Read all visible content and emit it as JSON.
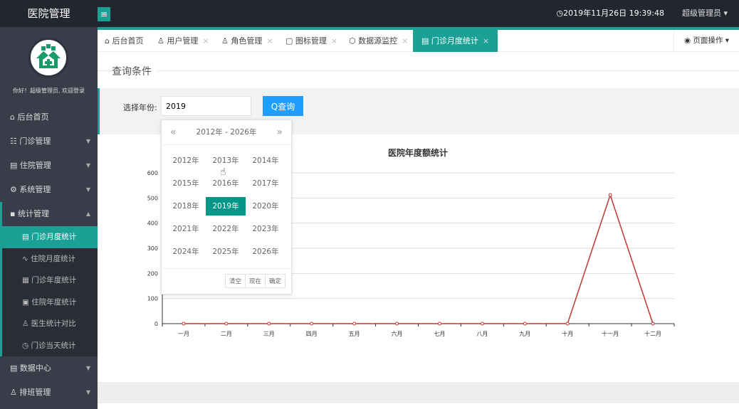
{
  "header": {
    "title": "医院管理",
    "menu_icon": "≡",
    "datetime": "2019年11月26日 19:39:48",
    "user": "超级管理员"
  },
  "sidebar": {
    "welcome": "你好！超级管理员, 欢迎登录",
    "items": [
      {
        "label": "后台首页",
        "icon": "⌂"
      },
      {
        "label": "门诊管理",
        "icon": "☷"
      },
      {
        "label": "住院管理",
        "icon": "▤"
      },
      {
        "label": "系统管理",
        "icon": "⚙"
      },
      {
        "label": "统计管理",
        "icon": "▪"
      }
    ],
    "sub": [
      {
        "label": "门诊月度统计",
        "icon": "▤"
      },
      {
        "label": "住院月度统计",
        "icon": "∿"
      },
      {
        "label": "门诊年度统计",
        "icon": "▦"
      },
      {
        "label": "住院年度统计",
        "icon": "▣"
      },
      {
        "label": "医生统计对比",
        "icon": "♙"
      },
      {
        "label": "门诊当天统计",
        "icon": "◷"
      }
    ],
    "after": [
      {
        "label": "数据中心",
        "icon": "▤"
      },
      {
        "label": "排班管理",
        "icon": "♙"
      }
    ]
  },
  "tabs": [
    {
      "label": "后台首页",
      "icon": "⌂"
    },
    {
      "label": "用户管理",
      "icon": "♙"
    },
    {
      "label": "角色管理",
      "icon": "♙"
    },
    {
      "label": "图标管理",
      "icon": "▢"
    },
    {
      "label": "数据源监控",
      "icon": "⬡"
    },
    {
      "label": "门诊月度统计",
      "icon": "▤"
    }
  ],
  "tab_close": "×",
  "page_ops": "◉ 页面操作 ▾",
  "query": {
    "section_title": "查询条件",
    "label": "选择年份:",
    "value": "2019",
    "button": "Q查询"
  },
  "picker": {
    "range": "2012年 - 2026年",
    "prev": "«",
    "next": "»",
    "years": [
      "2012年",
      "2013年",
      "2014年",
      "2015年",
      "2016年",
      "2017年",
      "2018年",
      "2019年",
      "2020年",
      "2021年",
      "2022年",
      "2023年",
      "2024年",
      "2025年",
      "2026年"
    ],
    "selected": "2019年",
    "clear": "清空",
    "now": "现在",
    "confirm": "确定"
  },
  "chart_data": {
    "type": "line",
    "title": "医院年度额统计",
    "categories": [
      "一月",
      "二月",
      "三月",
      "四月",
      "五月",
      "六月",
      "七月",
      "八月",
      "九月",
      "十月",
      "十一月",
      "十二月"
    ],
    "values": [
      0,
      0,
      0,
      0,
      0,
      0,
      0,
      0,
      0,
      0,
      512,
      0
    ],
    "ylim": [
      0,
      600
    ],
    "yticks": [
      0,
      100,
      200,
      300,
      400,
      500,
      600
    ],
    "grid": true,
    "color": "#c23531"
  }
}
